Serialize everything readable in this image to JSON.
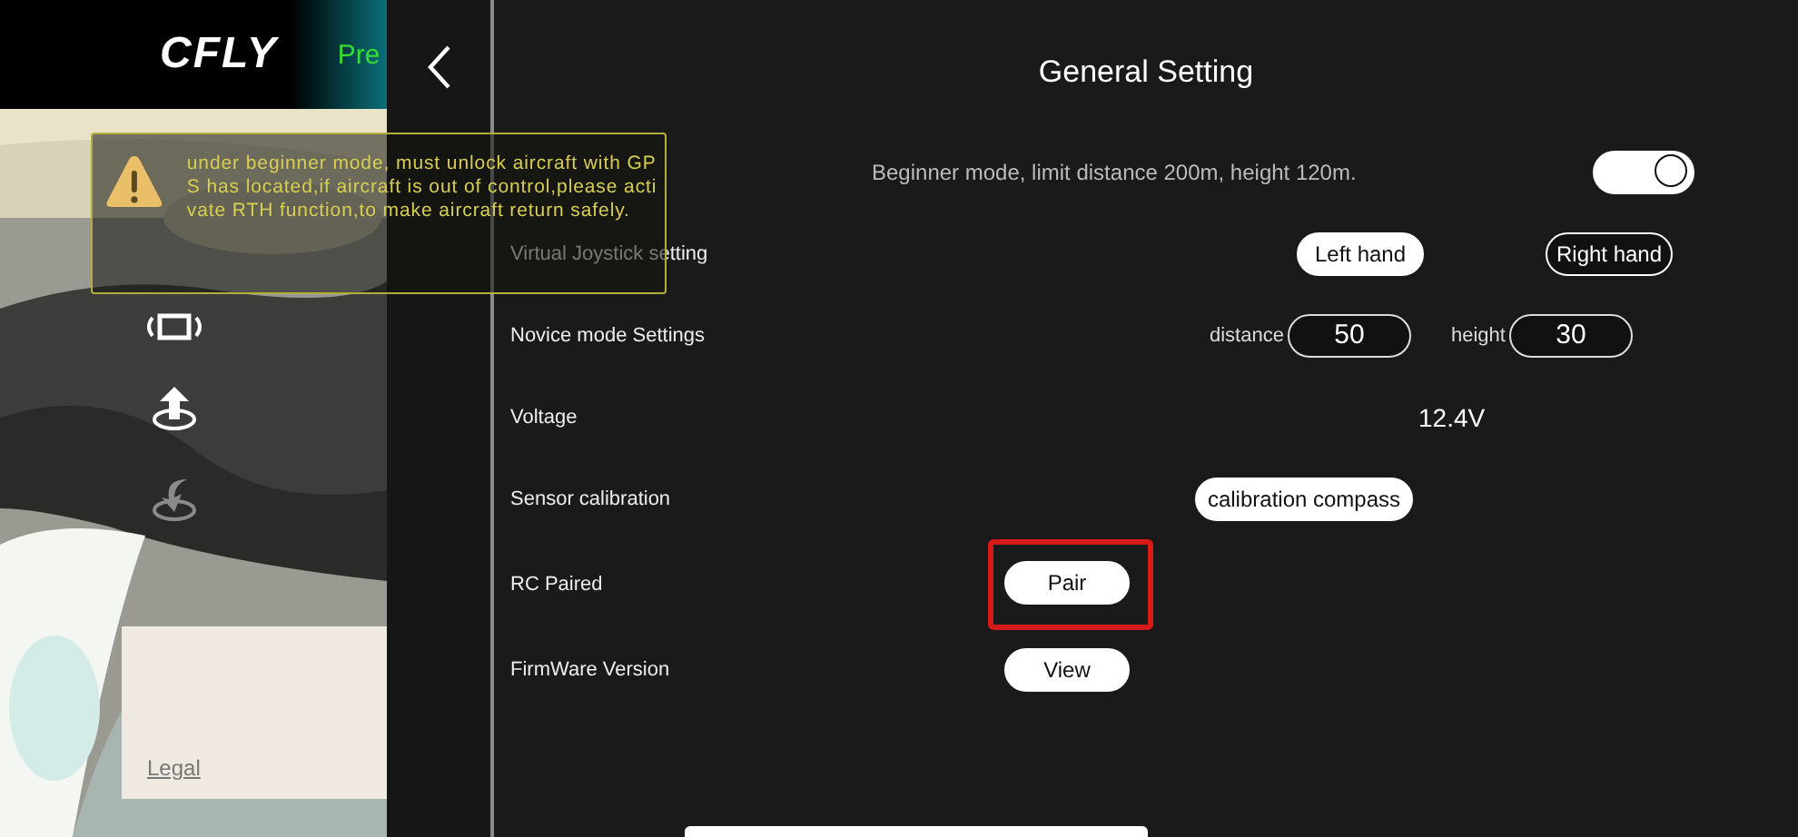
{
  "header": {
    "logo": "CFLY",
    "mode_label": "Pre"
  },
  "sidebar": {
    "tools": [
      {
        "kind": "rotate",
        "disabled": false
      },
      {
        "kind": "takeoff",
        "disabled": false
      },
      {
        "kind": "land",
        "disabled": true
      }
    ],
    "legal_link": "Legal"
  },
  "toast": {
    "message": "under beginner mode,  must unlock aircraft with GPS has located,if aircraft is out of control,please activate RTH function,to make aircraft return safely."
  },
  "settings": {
    "title": "General Setting",
    "rows": [
      {
        "kind": "toggle",
        "description": "Beginner mode, limit distance 200m, height 120m.",
        "on": true
      },
      {
        "kind": "choice",
        "label": "Virtual Joystick setting",
        "options": [
          {
            "label": "Left hand",
            "selected": true
          },
          {
            "label": "Right hand",
            "selected": false
          }
        ]
      },
      {
        "kind": "fields",
        "label": "Novice mode Settings",
        "fields": [
          {
            "label": "distance",
            "value": "50"
          },
          {
            "label": "height",
            "value": "30"
          }
        ]
      },
      {
        "kind": "value",
        "label": "Voltage",
        "value": "12.4V"
      },
      {
        "kind": "action",
        "label": "Sensor calibration",
        "button": "calibration compass",
        "annotated": false
      },
      {
        "kind": "button",
        "label": "RC Paired",
        "button": "Pair",
        "annotated": true
      },
      {
        "kind": "button",
        "label": "FirmWare Version",
        "button": "View",
        "annotated": false
      }
    ]
  }
}
